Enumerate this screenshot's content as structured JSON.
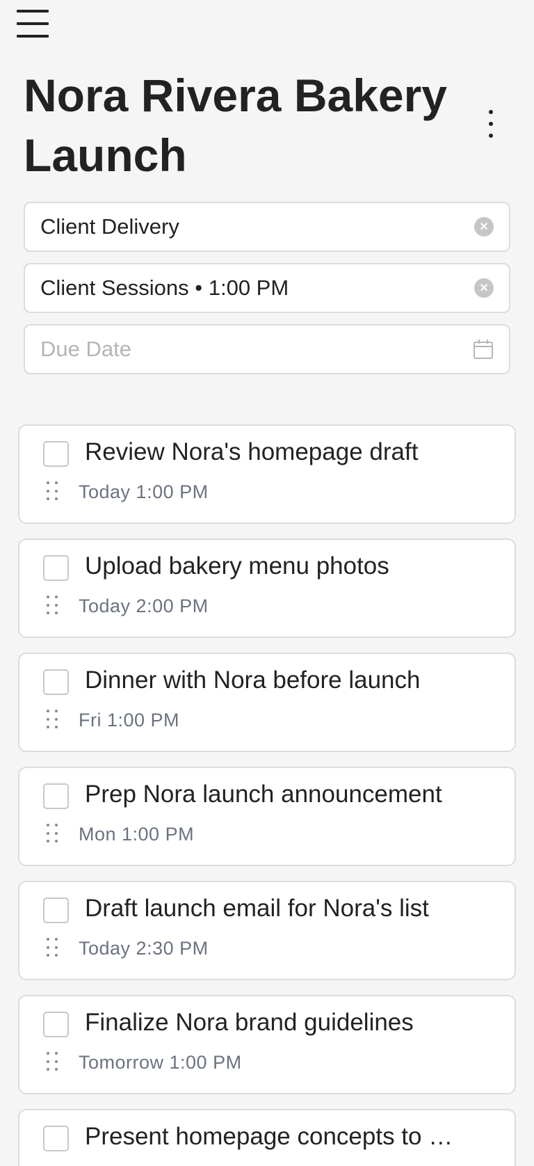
{
  "header": {
    "menu_icon": "hamburger-menu-icon",
    "title": "Nora Rivera Bakery Launch",
    "more_icon": "vertical-dots-icon"
  },
  "fields": {
    "list": {
      "value": "Client Delivery",
      "icon": "clear-icon"
    },
    "reminder": {
      "value": "Client Sessions • 1:00 PM",
      "icon": "clear-icon"
    },
    "due_date": {
      "placeholder": "Due Date",
      "icon": "calendar-icon"
    }
  },
  "colors": {
    "background": "#f5f5f5",
    "card": "#ffffff",
    "border": "#dcdcdc",
    "text": "#222222",
    "meta": "#6b7280",
    "clear_icon": "#c6c6c6"
  },
  "tasks": [
    {
      "title": "Review Nora's homepage draft",
      "due": "Today 1:00 PM"
    },
    {
      "title": "Upload bakery menu photos",
      "due": "Today 2:00 PM"
    },
    {
      "title": "Dinner with Nora before launch",
      "due": "Fri 1:00 PM"
    },
    {
      "title": "Prep Nora launch announcement",
      "due": "Mon 1:00 PM"
    },
    {
      "title": "Draft launch email for Nora's list",
      "due": "Today 2:30 PM"
    },
    {
      "title": "Finalize Nora brand guidelines",
      "due": "Tomorrow 1:00 PM"
    },
    {
      "title": "Present homepage concepts to …",
      "due": ""
    }
  ]
}
